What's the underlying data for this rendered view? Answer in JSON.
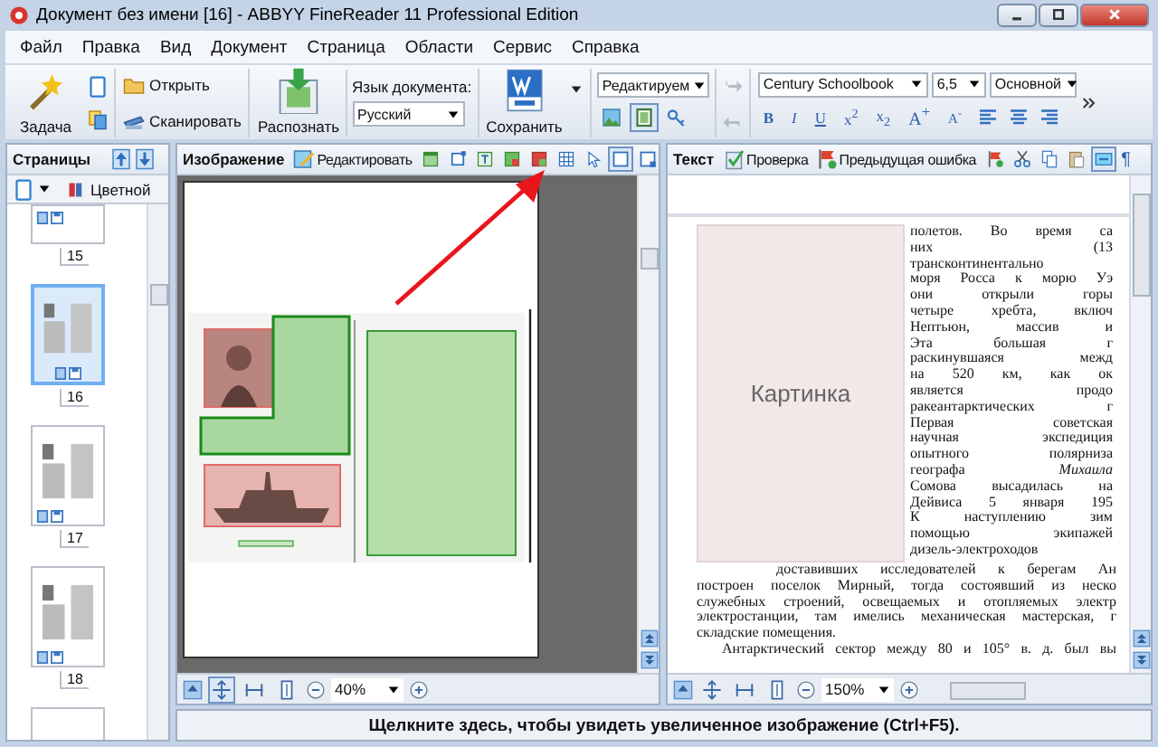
{
  "window": {
    "title": "Документ без имени [16] - ABBYY FineReader 11 Professional Edition"
  },
  "menu": [
    "Файл",
    "Правка",
    "Вид",
    "Документ",
    "Страница",
    "Области",
    "Сервис",
    "Справка"
  ],
  "toolbar": {
    "task": "Задача",
    "open": "Открыть",
    "scan": "Сканировать",
    "recognize": "Распознать",
    "language_label": "Язык документа:",
    "language": "Русский",
    "save": "Сохранить",
    "mode": "Редактируем",
    "view_toggles": [
      {
        "kind": "image",
        "selected": false
      },
      {
        "kind": "layout",
        "selected": true
      },
      {
        "kind": "key",
        "selected": false
      }
    ],
    "font": "Century Schoolbook",
    "size": "6,5",
    "style": "Основной",
    "format_buttons": [
      {
        "kind": "bold",
        "label": "B"
      },
      {
        "kind": "italic",
        "label": "I"
      },
      {
        "kind": "underline",
        "label": "U"
      },
      {
        "kind": "plain",
        "label": "x$^{2}$"
      },
      {
        "kind": "plain",
        "label": "x$_{2}$"
      },
      {
        "kind": "big",
        "label": "A$^{+}$"
      },
      {
        "kind": "small",
        "label": "A$^{-}$"
      }
    ]
  },
  "pages_panel": {
    "title": "Страницы",
    "color_mode": "Цветной",
    "pages": [
      {
        "number": "15",
        "selected": false
      },
      {
        "number": "16",
        "selected": true
      },
      {
        "number": "17",
        "selected": false
      },
      {
        "number": "18",
        "selected": false
      }
    ]
  },
  "image_panel": {
    "title": "Изображение",
    "edit": "Редактировать",
    "tools": [
      {
        "kind": "block",
        "selected": false
      },
      {
        "kind": "frame",
        "selected": false
      },
      {
        "kind": "textblock",
        "selected": false
      },
      {
        "kind": "picblock",
        "selected": false
      },
      {
        "kind": "picblock2",
        "selected": false
      },
      {
        "kind": "table",
        "selected": false
      },
      {
        "kind": "pointer",
        "selected": false
      },
      {
        "kind": "rect",
        "selected": true
      },
      {
        "kind": "rectcorner",
        "selected": false
      }
    ],
    "fit_buttons": [
      {
        "kind": "fitpage",
        "selected": true
      },
      {
        "kind": "fitwidth",
        "selected": false
      },
      {
        "kind": "fitheight",
        "selected": false
      }
    ],
    "zoom": "40%"
  },
  "text_panel": {
    "title": "Текст",
    "check": "Проверка",
    "prev_error": "Предыдущая ошибка",
    "tools": [
      {
        "kind": "flag",
        "selected": false
      },
      {
        "kind": "scissors",
        "selected": false
      },
      {
        "kind": "copy",
        "selected": false
      },
      {
        "kind": "paste",
        "selected": false
      },
      {
        "kind": "highlight",
        "selected": true
      }
    ],
    "pilcrow": "¶",
    "picture_label": "Картинка",
    "side_lines": [
      "полетов. Во время са",
      "них (13",
      "трансконтинентально",
      "моря Росса к морю Уэ",
      "они открыли горы",
      "четыре хребта, включ",
      "Нептьюн, массив и",
      "Эта большая г",
      "раскинувшаяся межд",
      "на 520 км, как ок",
      "является продо",
      "ракеантарктических г",
      "Первая советская",
      "научная экспедиция",
      "опытного полярниза",
      "географа *Михаила*",
      "Сомова высадилась на",
      "Дейвиса 5 января 195",
      "К наступлению зим",
      "помощью экипажей",
      "дизель-электроходов"
    ],
    "lines": [
      {
        "kind": "after_picture",
        "text": "доставивших исследователей к берегам Ан"
      },
      {
        "kind": "full",
        "text": "построен поселок Мирный, тогда состоявший из неско"
      },
      {
        "kind": "full",
        "text": "служебных строений, освещаемых и отопляемых электр"
      },
      {
        "kind": "full",
        "text": "электростанции, там имелись механическая мастерская, г"
      },
      {
        "kind": "end",
        "text": "складские помещения."
      },
      {
        "kind": "indent",
        "text": "Антарктический сектор между 80 и 105° в. д. был вы"
      }
    ],
    "fit_buttons": [
      {
        "kind": "fitpage",
        "selected": false
      },
      {
        "kind": "fitwidth",
        "selected": false
      },
      {
        "kind": "fitheight",
        "selected": false
      }
    ],
    "zoom": "150%"
  },
  "status_bar": "Щелкните здесь, чтобы увидеть увеличенное изображение (Ctrl+F5)."
}
